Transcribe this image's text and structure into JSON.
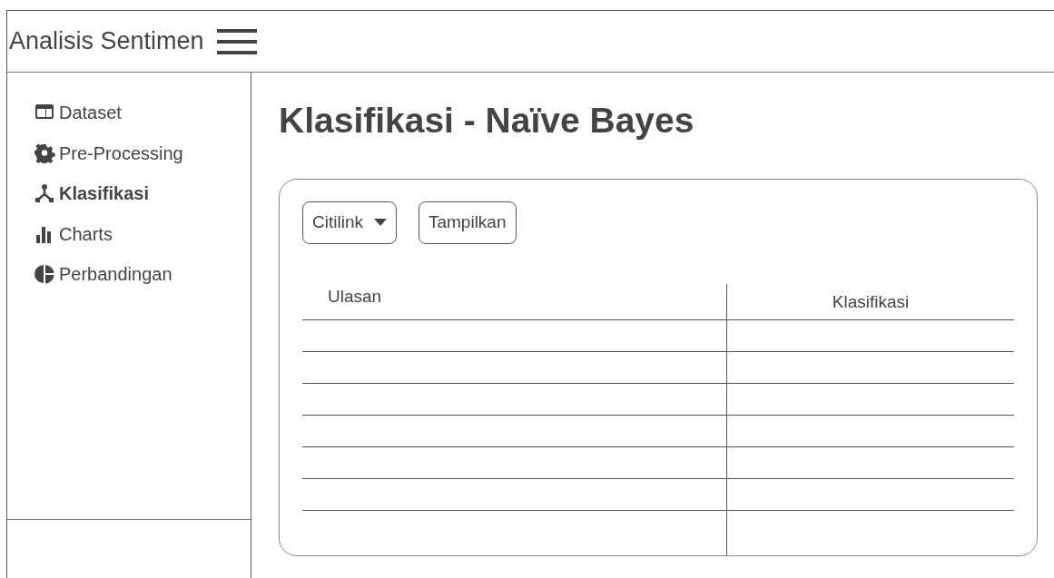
{
  "app": {
    "title": "Analisis Sentimen"
  },
  "sidebar": {
    "items": [
      {
        "label": "Dataset",
        "selected": false
      },
      {
        "label": "Pre-Processing",
        "selected": false
      },
      {
        "label": "Klasifikasi",
        "selected": true
      },
      {
        "label": "Charts",
        "selected": false
      },
      {
        "label": "Perbandingan",
        "selected": false
      }
    ]
  },
  "page": {
    "heading": "Klasifikasi - Naïve Bayes"
  },
  "toolbar": {
    "dropdown": {
      "value": "Citilink"
    },
    "button": "Tampilkan"
  },
  "table": {
    "columns": [
      "Ulasan",
      "Klasifikasi"
    ]
  }
}
